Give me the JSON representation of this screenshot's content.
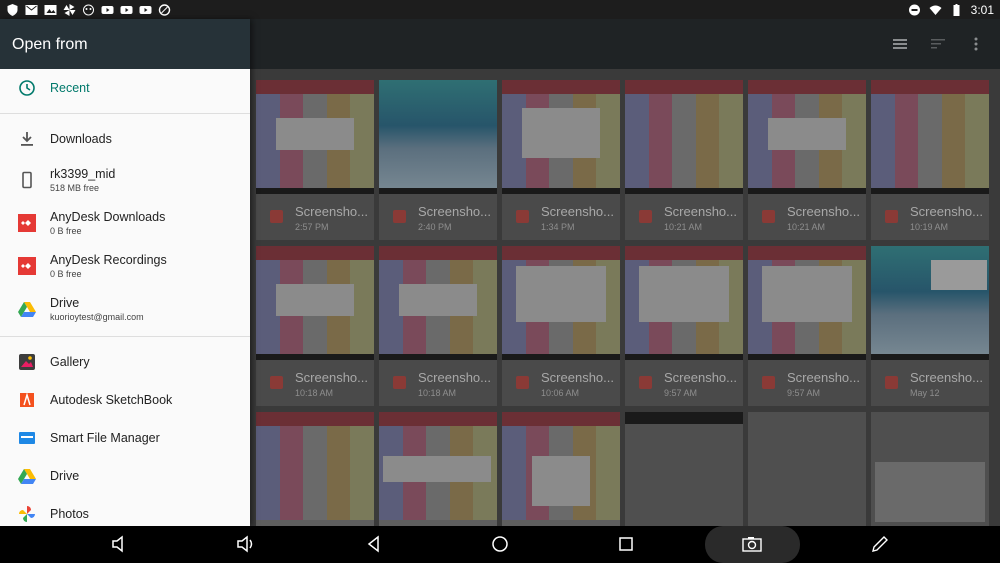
{
  "status_bar": {
    "time": "3:01"
  },
  "drawer": {
    "title": "Open from",
    "items": [
      {
        "label": "Recent",
        "sub": "",
        "icon": "clock-icon",
        "active": true
      },
      {
        "label": "Downloads",
        "sub": "",
        "icon": "download-icon"
      },
      {
        "label": "rk3399_mid",
        "sub": "518 MB free",
        "icon": "phone-icon"
      },
      {
        "label": "AnyDesk Downloads",
        "sub": "0 B free",
        "icon": "anydesk-icon"
      },
      {
        "label": "AnyDesk Recordings",
        "sub": "0 B free",
        "icon": "anydesk-icon"
      },
      {
        "label": "Drive",
        "sub": "kuorioytest@gmail.com",
        "icon": "drive-icon"
      },
      {
        "label": "Gallery",
        "sub": "",
        "icon": "gallery-icon"
      },
      {
        "label": "Autodesk SketchBook",
        "sub": "",
        "icon": "sketchbook-icon"
      },
      {
        "label": "Smart File Manager",
        "sub": "",
        "icon": "file-manager-icon"
      },
      {
        "label": "Drive",
        "sub": "",
        "icon": "drive-icon"
      },
      {
        "label": "Photos",
        "sub": "",
        "icon": "photos-icon"
      }
    ]
  },
  "files": {
    "cards": [
      {
        "name": "Screensho...",
        "time": "2:57 PM",
        "thumb": "calendar"
      },
      {
        "name": "Screensho...",
        "time": "2:40 PM",
        "thumb": "photo"
      },
      {
        "name": "Screensho...",
        "time": "1:34 PM",
        "thumb": "calendar"
      },
      {
        "name": "Screensho...",
        "time": "10:21 AM",
        "thumb": "calendar"
      },
      {
        "name": "Screensho...",
        "time": "10:21 AM",
        "thumb": "calendar"
      },
      {
        "name": "Screensho...",
        "time": "10:19 AM",
        "thumb": "calendar"
      },
      {
        "name": "Screensho...",
        "time": "10:18 AM",
        "thumb": "calendar"
      },
      {
        "name": "Screensho...",
        "time": "10:18 AM",
        "thumb": "calendar"
      },
      {
        "name": "Screensho...",
        "time": "10:06 AM",
        "thumb": "calendar"
      },
      {
        "name": "Screensho...",
        "time": "9:57 AM",
        "thumb": "calendar"
      },
      {
        "name": "Screensho...",
        "time": "9:57 AM",
        "thumb": "calendar"
      },
      {
        "name": "Screensho...",
        "time": "May 12",
        "thumb": "photo"
      },
      {
        "name": "",
        "time": "",
        "thumb": "calendar"
      },
      {
        "name": "",
        "time": "",
        "thumb": "calendar"
      },
      {
        "name": "",
        "time": "",
        "thumb": "calendar"
      },
      {
        "name": "",
        "time": "",
        "thumb": "blank"
      },
      {
        "name": "",
        "time": "",
        "thumb": "blank"
      },
      {
        "name": "",
        "time": "",
        "thumb": "blank"
      }
    ]
  },
  "colors": {
    "drawer_header": "#263238",
    "accent": "#00796b",
    "drawer_bg": "#fafafa"
  }
}
